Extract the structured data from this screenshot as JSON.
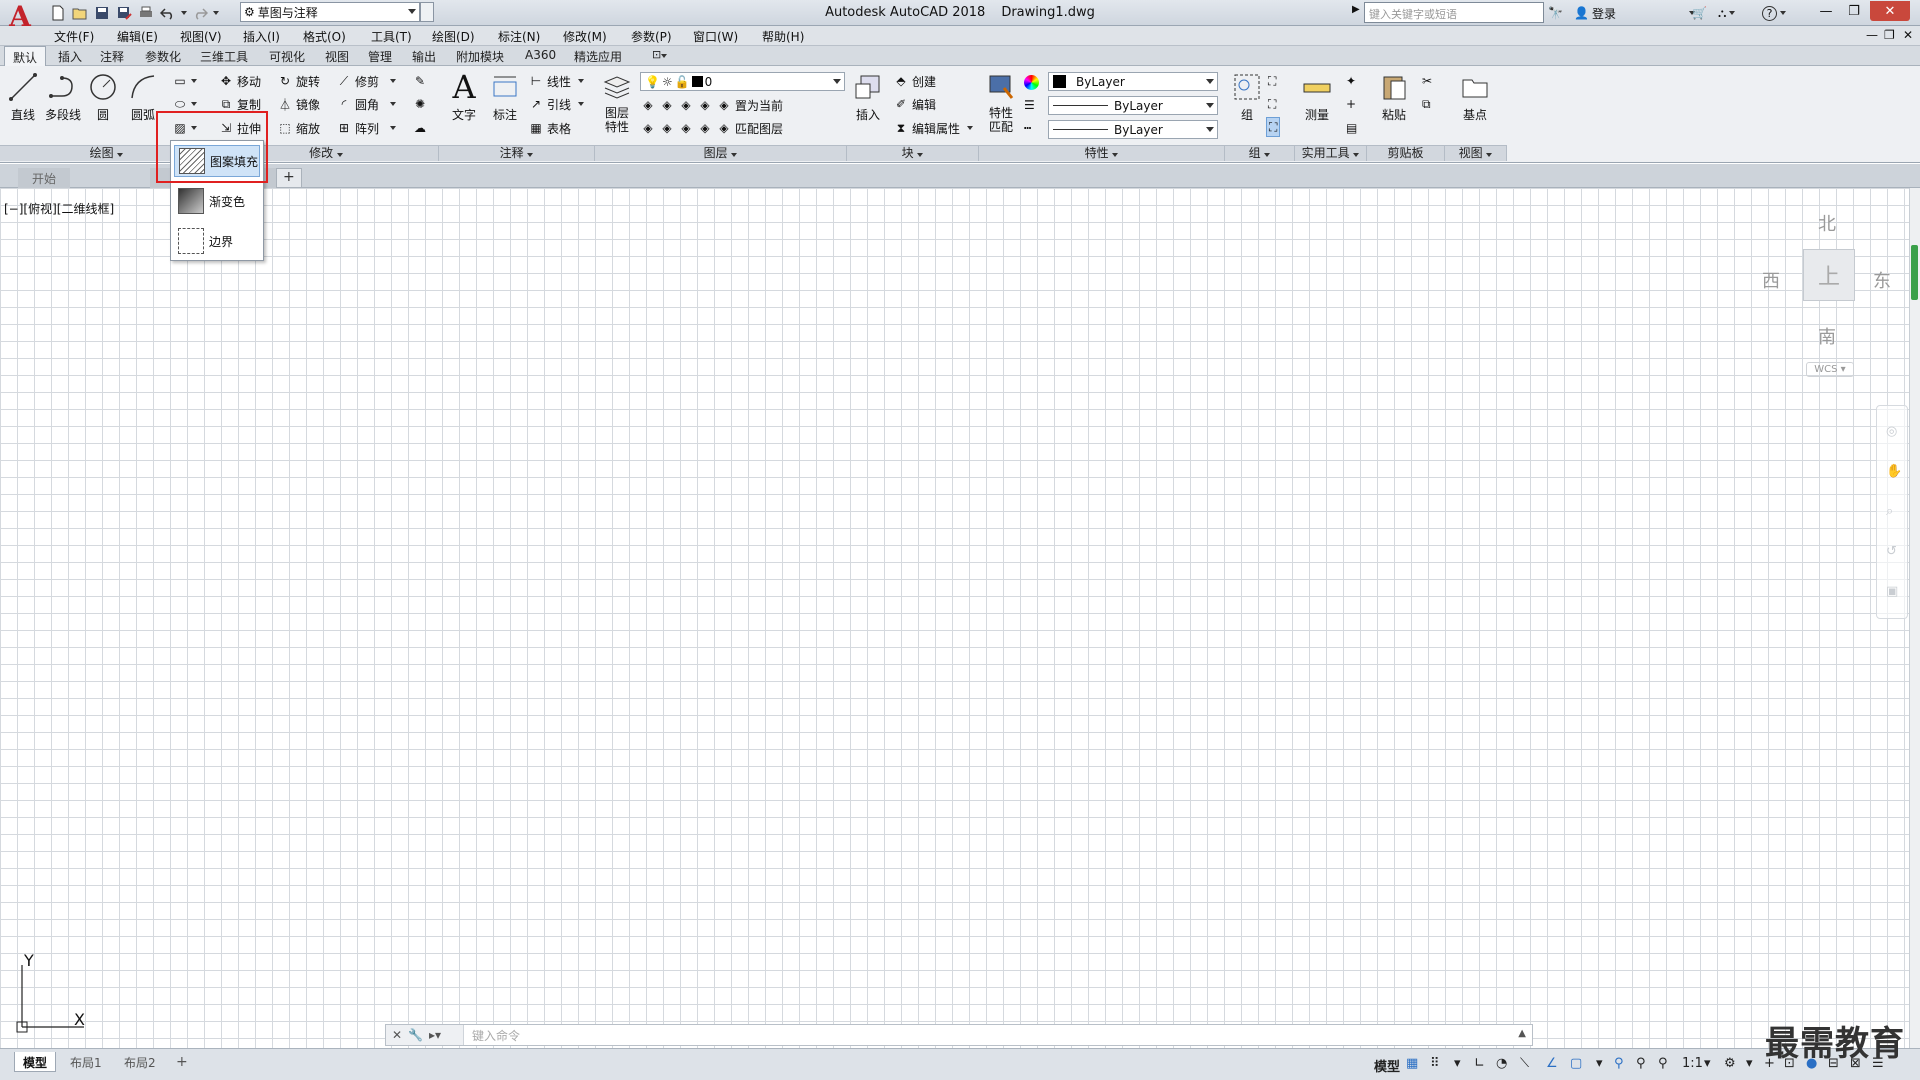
{
  "app": {
    "title": "Autodesk AutoCAD 2018",
    "document": "Drawing1.dwg",
    "logo": "A"
  },
  "quick_access": {
    "workspace": "草图与注释",
    "icons": [
      "new-icon",
      "open-icon",
      "save-icon",
      "saveas-icon",
      "print-icon",
      "undo-icon",
      "redo-icon"
    ]
  },
  "title_right": {
    "search_placeholder": "键入关键字或短语",
    "login": "登录",
    "help": "?"
  },
  "window_buttons": [
    "—",
    "❐",
    "✕"
  ],
  "menubar": {
    "items": [
      "文件(F)",
      "编辑(E)",
      "视图(V)",
      "插入(I)",
      "格式(O)",
      "工具(T)",
      "绘图(D)",
      "标注(N)",
      "修改(M)",
      "参数(P)",
      "窗口(W)",
      "帮助(H)"
    ],
    "mdi": [
      "—",
      "❐",
      "✕"
    ]
  },
  "ribbon_tabs": [
    "默认",
    "插入",
    "注释",
    "参数化",
    "三维工具",
    "可视化",
    "视图",
    "管理",
    "输出",
    "附加模块",
    "A360",
    "精选应用"
  ],
  "draw_panel": {
    "title": "绘图",
    "line": "直线",
    "polyline": "多段线",
    "circle": "圆",
    "arc": "圆弧"
  },
  "modify_panel": {
    "title": "修改",
    "move": "移动",
    "rotate": "旋转",
    "trim": "修剪",
    "copy": "复制",
    "mirror": "镜像",
    "fillet": "圆角",
    "stretch": "拉伸",
    "scale": "缩放",
    "array": "阵列"
  },
  "annotation_panel": {
    "title": "注释",
    "text": "文字",
    "dimension": "标注",
    "linear": "线性",
    "leader": "引线",
    "table": "表格"
  },
  "layers_panel": {
    "title": "图层",
    "properties": "图层特性",
    "props_line1": "图层",
    "props_line2": "特性",
    "layer_name": "0",
    "set_current": "置为当前",
    "match": "匹配图层"
  },
  "block_panel": {
    "title": "块",
    "insert": "插入",
    "create": "创建",
    "edit": "编辑",
    "edit_attr": "编辑属性"
  },
  "properties_panel": {
    "title": "特性",
    "match_line1": "特性",
    "match_line2": "匹配",
    "color": "ByLayer",
    "linetype": "ByLayer",
    "lineweight": "ByLayer"
  },
  "groups_panel": {
    "title": "组",
    "group": "组"
  },
  "utilities_panel": {
    "title": "实用工具",
    "measure": "测量"
  },
  "clipboard_panel": {
    "title": "剪贴板",
    "paste": "粘贴"
  },
  "view_panel": {
    "title": "视图",
    "base": "基点"
  },
  "hatch_flyout": {
    "items": [
      "图案填充",
      "渐变色",
      "边界"
    ]
  },
  "doc_tabs": {
    "start": "开始",
    "add": "+"
  },
  "viewport": {
    "label": "[−][俯视][二维线框]",
    "north": "北",
    "south": "南",
    "east": "东",
    "west": "西",
    "cube_face": "上",
    "wcs": "WCS"
  },
  "ucs": {
    "x": "X",
    "y": "Y"
  },
  "command_line": {
    "placeholder": "键入命令"
  },
  "status": {
    "layout_tabs": [
      "模型",
      "布局1",
      "布局2"
    ],
    "add": "+",
    "model": "模型",
    "scale": "1:1"
  },
  "watermark": "最需教育"
}
